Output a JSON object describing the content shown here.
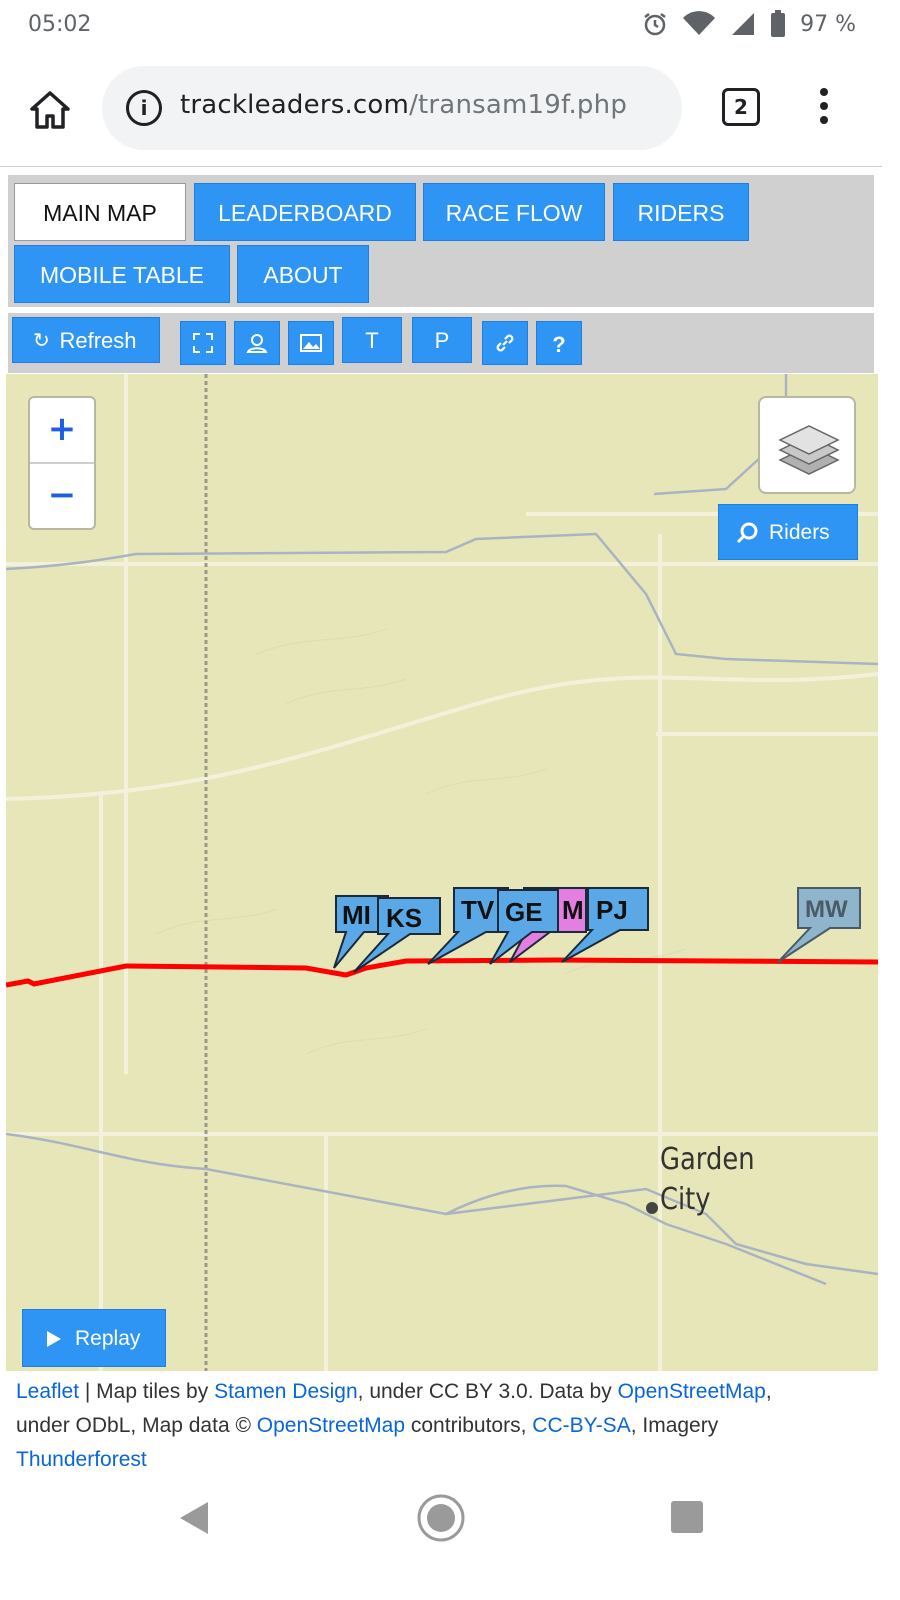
{
  "status": {
    "time": "05:02",
    "battery": "97 %"
  },
  "browser": {
    "url_host": "trackleaders.com",
    "url_path": "/transam19f.php",
    "tab_count": "2"
  },
  "nav": {
    "tabs": [
      "MAIN MAP",
      "LEADERBOARD",
      "RACE FLOW",
      "RIDERS",
      "MOBILE TABLE",
      "ABOUT"
    ]
  },
  "toolbar": {
    "refresh": "Refresh",
    "t": "T",
    "p": "P",
    "help": "?"
  },
  "map": {
    "zoom_in": "+",
    "zoom_out": "−",
    "riders_button": "Riders",
    "replay_button": "Replay",
    "city_line1": "Garden",
    "city_line2": "City",
    "markers": [
      {
        "label": "MI",
        "color": "#5aa9e6"
      },
      {
        "label": "KS",
        "color": "#5aa9e6"
      },
      {
        "label": "TV",
        "color": "#5aa9e6"
      },
      {
        "label": "GE",
        "color": "#5aa9e6"
      },
      {
        "label": "M",
        "color": "#e27fe0"
      },
      {
        "label": "PJ",
        "color": "#5aa9e6"
      },
      {
        "label": "MW",
        "color": "#8fb5cc"
      }
    ]
  },
  "attribution": {
    "leaflet": "Leaflet",
    "sep1": " | Map tiles by ",
    "stamen": "Stamen Design",
    "t2": ", under CC BY 3.0. Data by ",
    "osm1": "OpenStreetMap",
    "t3": ",",
    "t4": "under ODbL, Map data © ",
    "osm2": "OpenStreetMap",
    "t5": " contributors, ",
    "ccbysa": "CC-BY-SA",
    "t6": ", Imagery",
    "thunderforest": "Thunderforest"
  }
}
